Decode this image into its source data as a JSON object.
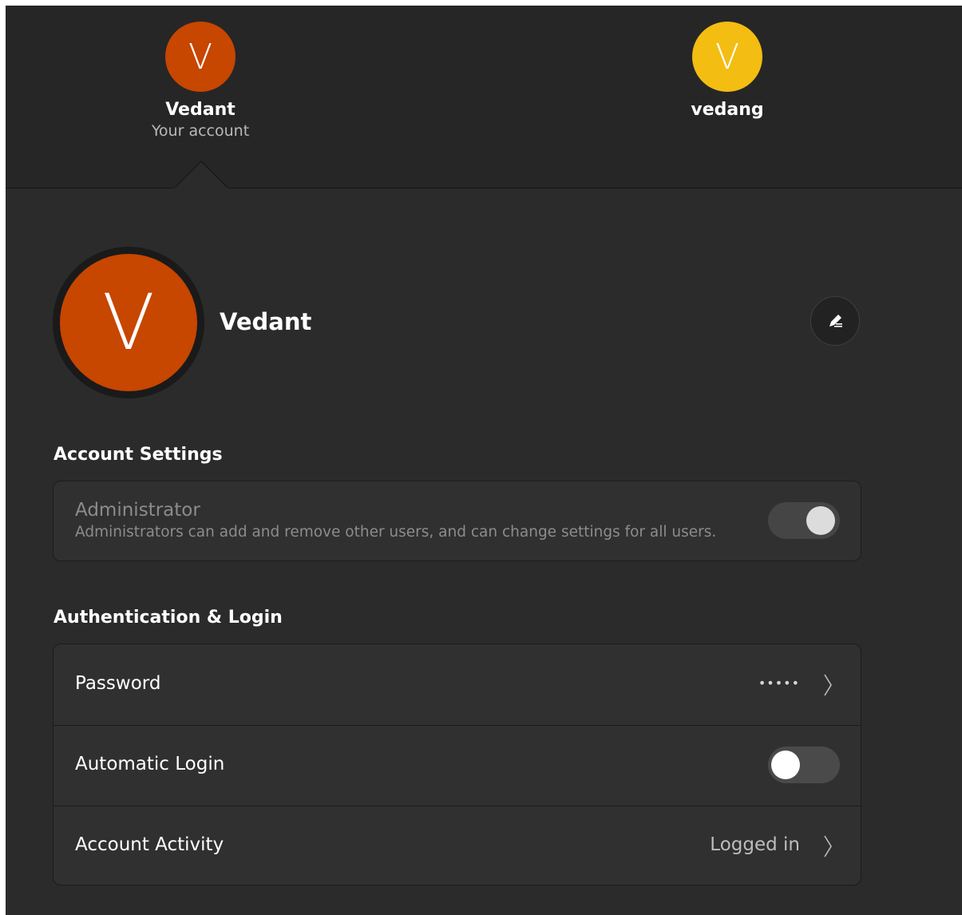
{
  "users": [
    {
      "initial": "V",
      "name": "Vedant",
      "subtitle": "Your account",
      "avatar_color": "#c74600"
    },
    {
      "initial": "V",
      "name": "vedang",
      "subtitle": "",
      "avatar_color": "#f3bd12"
    }
  ],
  "profile": {
    "initial": "V",
    "name": "Vedant",
    "avatar_color": "#c74600",
    "edit_icon": "pencil-icon"
  },
  "account_settings": {
    "title": "Account Settings",
    "administrator": {
      "label": "Administrator",
      "description": "Administrators can add and remove other users, and can change settings for all users.",
      "enabled": true,
      "disabled": true
    }
  },
  "authentication": {
    "title": "Authentication & Login",
    "password": {
      "label": "Password",
      "value": "•••••",
      "icon": "chevron-right-icon"
    },
    "automatic_login": {
      "label": "Automatic Login",
      "enabled": false
    },
    "account_activity": {
      "label": "Account Activity",
      "value": "Logged in",
      "icon": "chevron-right-icon"
    }
  },
  "colors": {
    "background": "#2b2b2b",
    "strip_background": "#262626",
    "row_background": "#303030"
  }
}
